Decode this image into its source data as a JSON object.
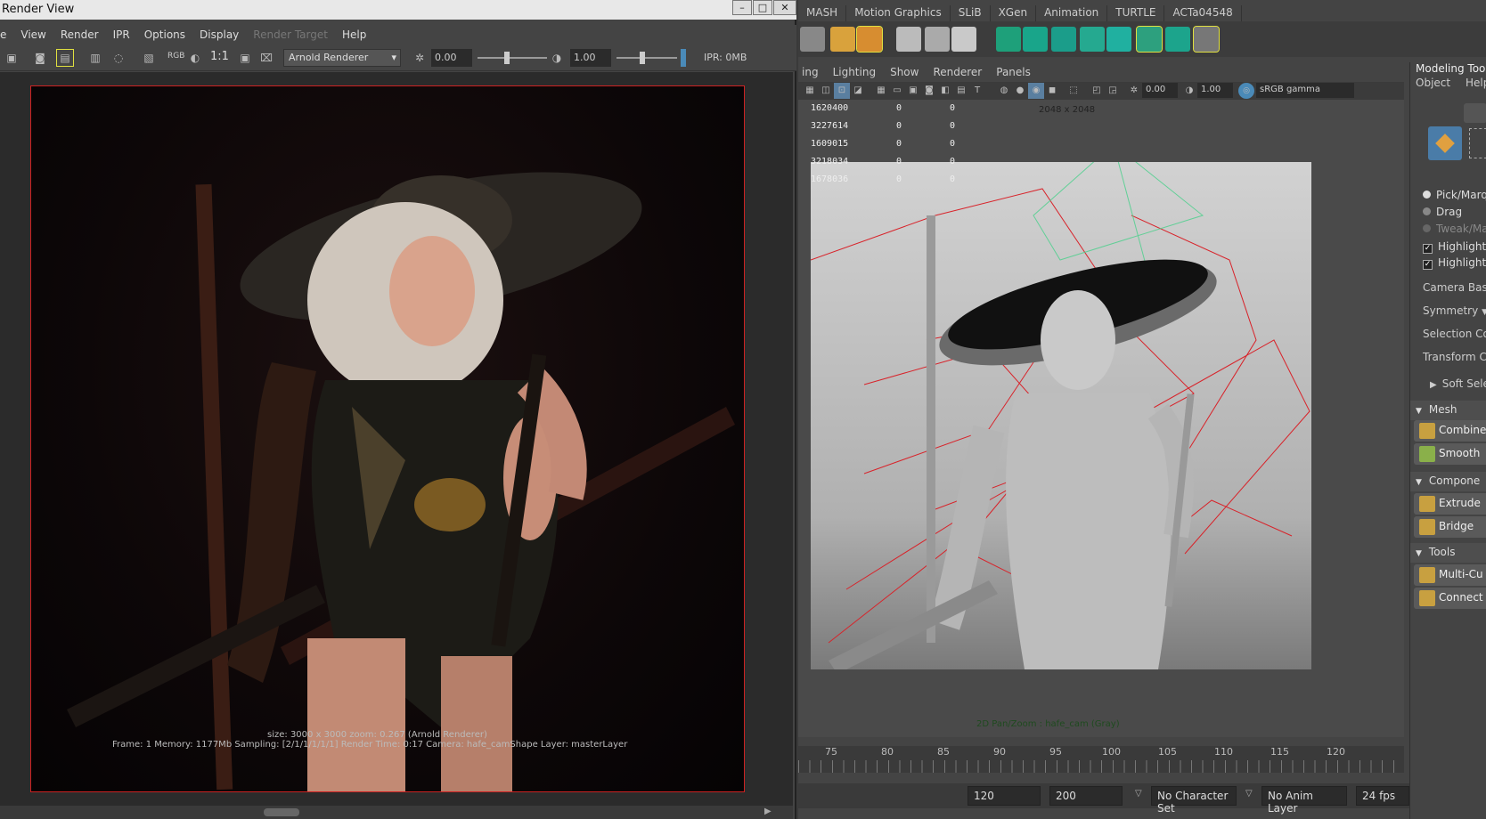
{
  "render_view": {
    "title": "Render View",
    "menu": [
      "e",
      "View",
      "Render",
      "IPR",
      "Options",
      "Display",
      "Render Target",
      "Help"
    ],
    "disabled_menu": "Render Target",
    "toolbar": {
      "rgb_label": "RGB",
      "ratio_label": "1:1",
      "renderer": "Arnold Renderer",
      "exposure": "0.00",
      "gamma": "1.00",
      "ipr_memory": "IPR: 0MB"
    },
    "status_line1": "size: 3000 x 3000  zoom: 0.267     (Arnold Renderer)",
    "status_line2": "Frame: 1     Memory: 1177Mb     Sampling: [2/1/1/1/1/1]     Render Time: 0:17     Camera: hafe_camShape     Layer: masterLayer"
  },
  "maya": {
    "shelf_tabs": [
      "MASH",
      "Motion Graphics",
      "SLiB",
      "XGen",
      "Animation",
      "TURTLE",
      "ACTa04548"
    ],
    "viewport_menu": [
      "ing",
      "Lighting",
      "Show",
      "Renderer",
      "Panels"
    ],
    "viewport_toolbar": {
      "exposure": "0.00",
      "gamma": "1.00",
      "colorspace": "sRGB gamma"
    },
    "hud_rows": [
      [
        "1620400",
        "0",
        "0"
      ],
      [
        "3227614",
        "0",
        "0"
      ],
      [
        "1609015",
        "0",
        "0"
      ],
      [
        "3218034",
        "0",
        "0"
      ],
      [
        "1678036",
        "0",
        "0"
      ]
    ],
    "resolution_gate": "2048 x 2048",
    "camera_label": "2D Pan/Zoom : hafe_cam (Gray)",
    "timeline_ticks": [
      "75",
      "80",
      "85",
      "90",
      "95",
      "100",
      "105",
      "110",
      "115",
      "120"
    ],
    "current_frame": "1",
    "range_start": "120",
    "range_end": "200",
    "character_set": "No Character Set",
    "anim_layer": "No Anim Layer",
    "fps": "24 fps"
  },
  "modeling_toolkit": {
    "title": "Modeling Toolk",
    "menu": [
      "Object",
      "Help"
    ],
    "options": [
      "Pick/Marqu",
      "Drag",
      "Tweak/Mar"
    ],
    "checks": [
      "Highlight",
      "Highlight"
    ],
    "labels": [
      "Camera Based",
      "Symmetry",
      "Selection Con",
      "Transform Con"
    ],
    "soft_select": "Soft Sele",
    "sections": {
      "mesh": {
        "title": "Mesh",
        "buttons": [
          "Combine",
          "Smooth"
        ]
      },
      "components": {
        "title": "Compone",
        "buttons": [
          "Extrude",
          "Bridge"
        ]
      },
      "tools": {
        "title": "Tools",
        "buttons": [
          "Multi-Cu",
          "Connect"
        ]
      }
    }
  }
}
